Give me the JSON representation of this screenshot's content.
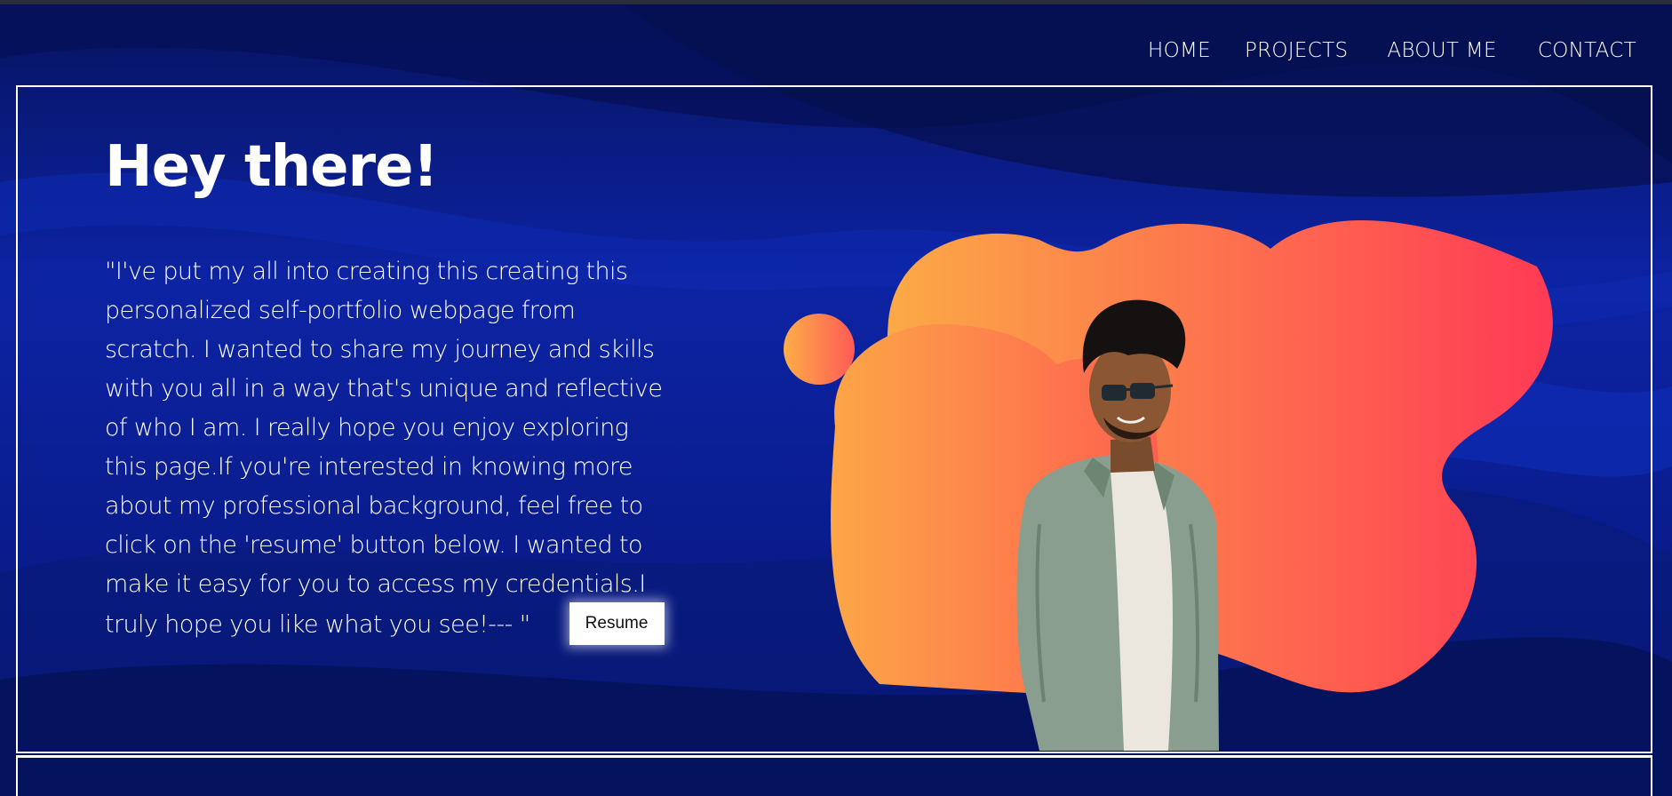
{
  "nav": {
    "items": [
      {
        "label": "HOME"
      },
      {
        "label": "PROJECTS"
      },
      {
        "label": "ABOUT ME"
      },
      {
        "label": "CONTACT"
      }
    ]
  },
  "hero": {
    "title": "Hey there!",
    "intro": "\"I've put my all into creating this creating this personalized self-portfolio webpage from scratch. I wanted to share my journey and skills with you all in a way that's unique and reflective of who I am. I really hope you enjoy exploring this page.If you're interested in knowing more about my professional background, feel free to click on the 'resume' button below. I wanted to make it easy for you to access my credentials.I truly hope you like what you see!--- \"",
    "resume_label": "Resume"
  },
  "colors": {
    "background": "#0a1a8c",
    "blob_start": "#fbaa46",
    "blob_end": "#ff3a55",
    "text": "#ffffff"
  },
  "icons": {
    "portrait": "person-photo"
  }
}
